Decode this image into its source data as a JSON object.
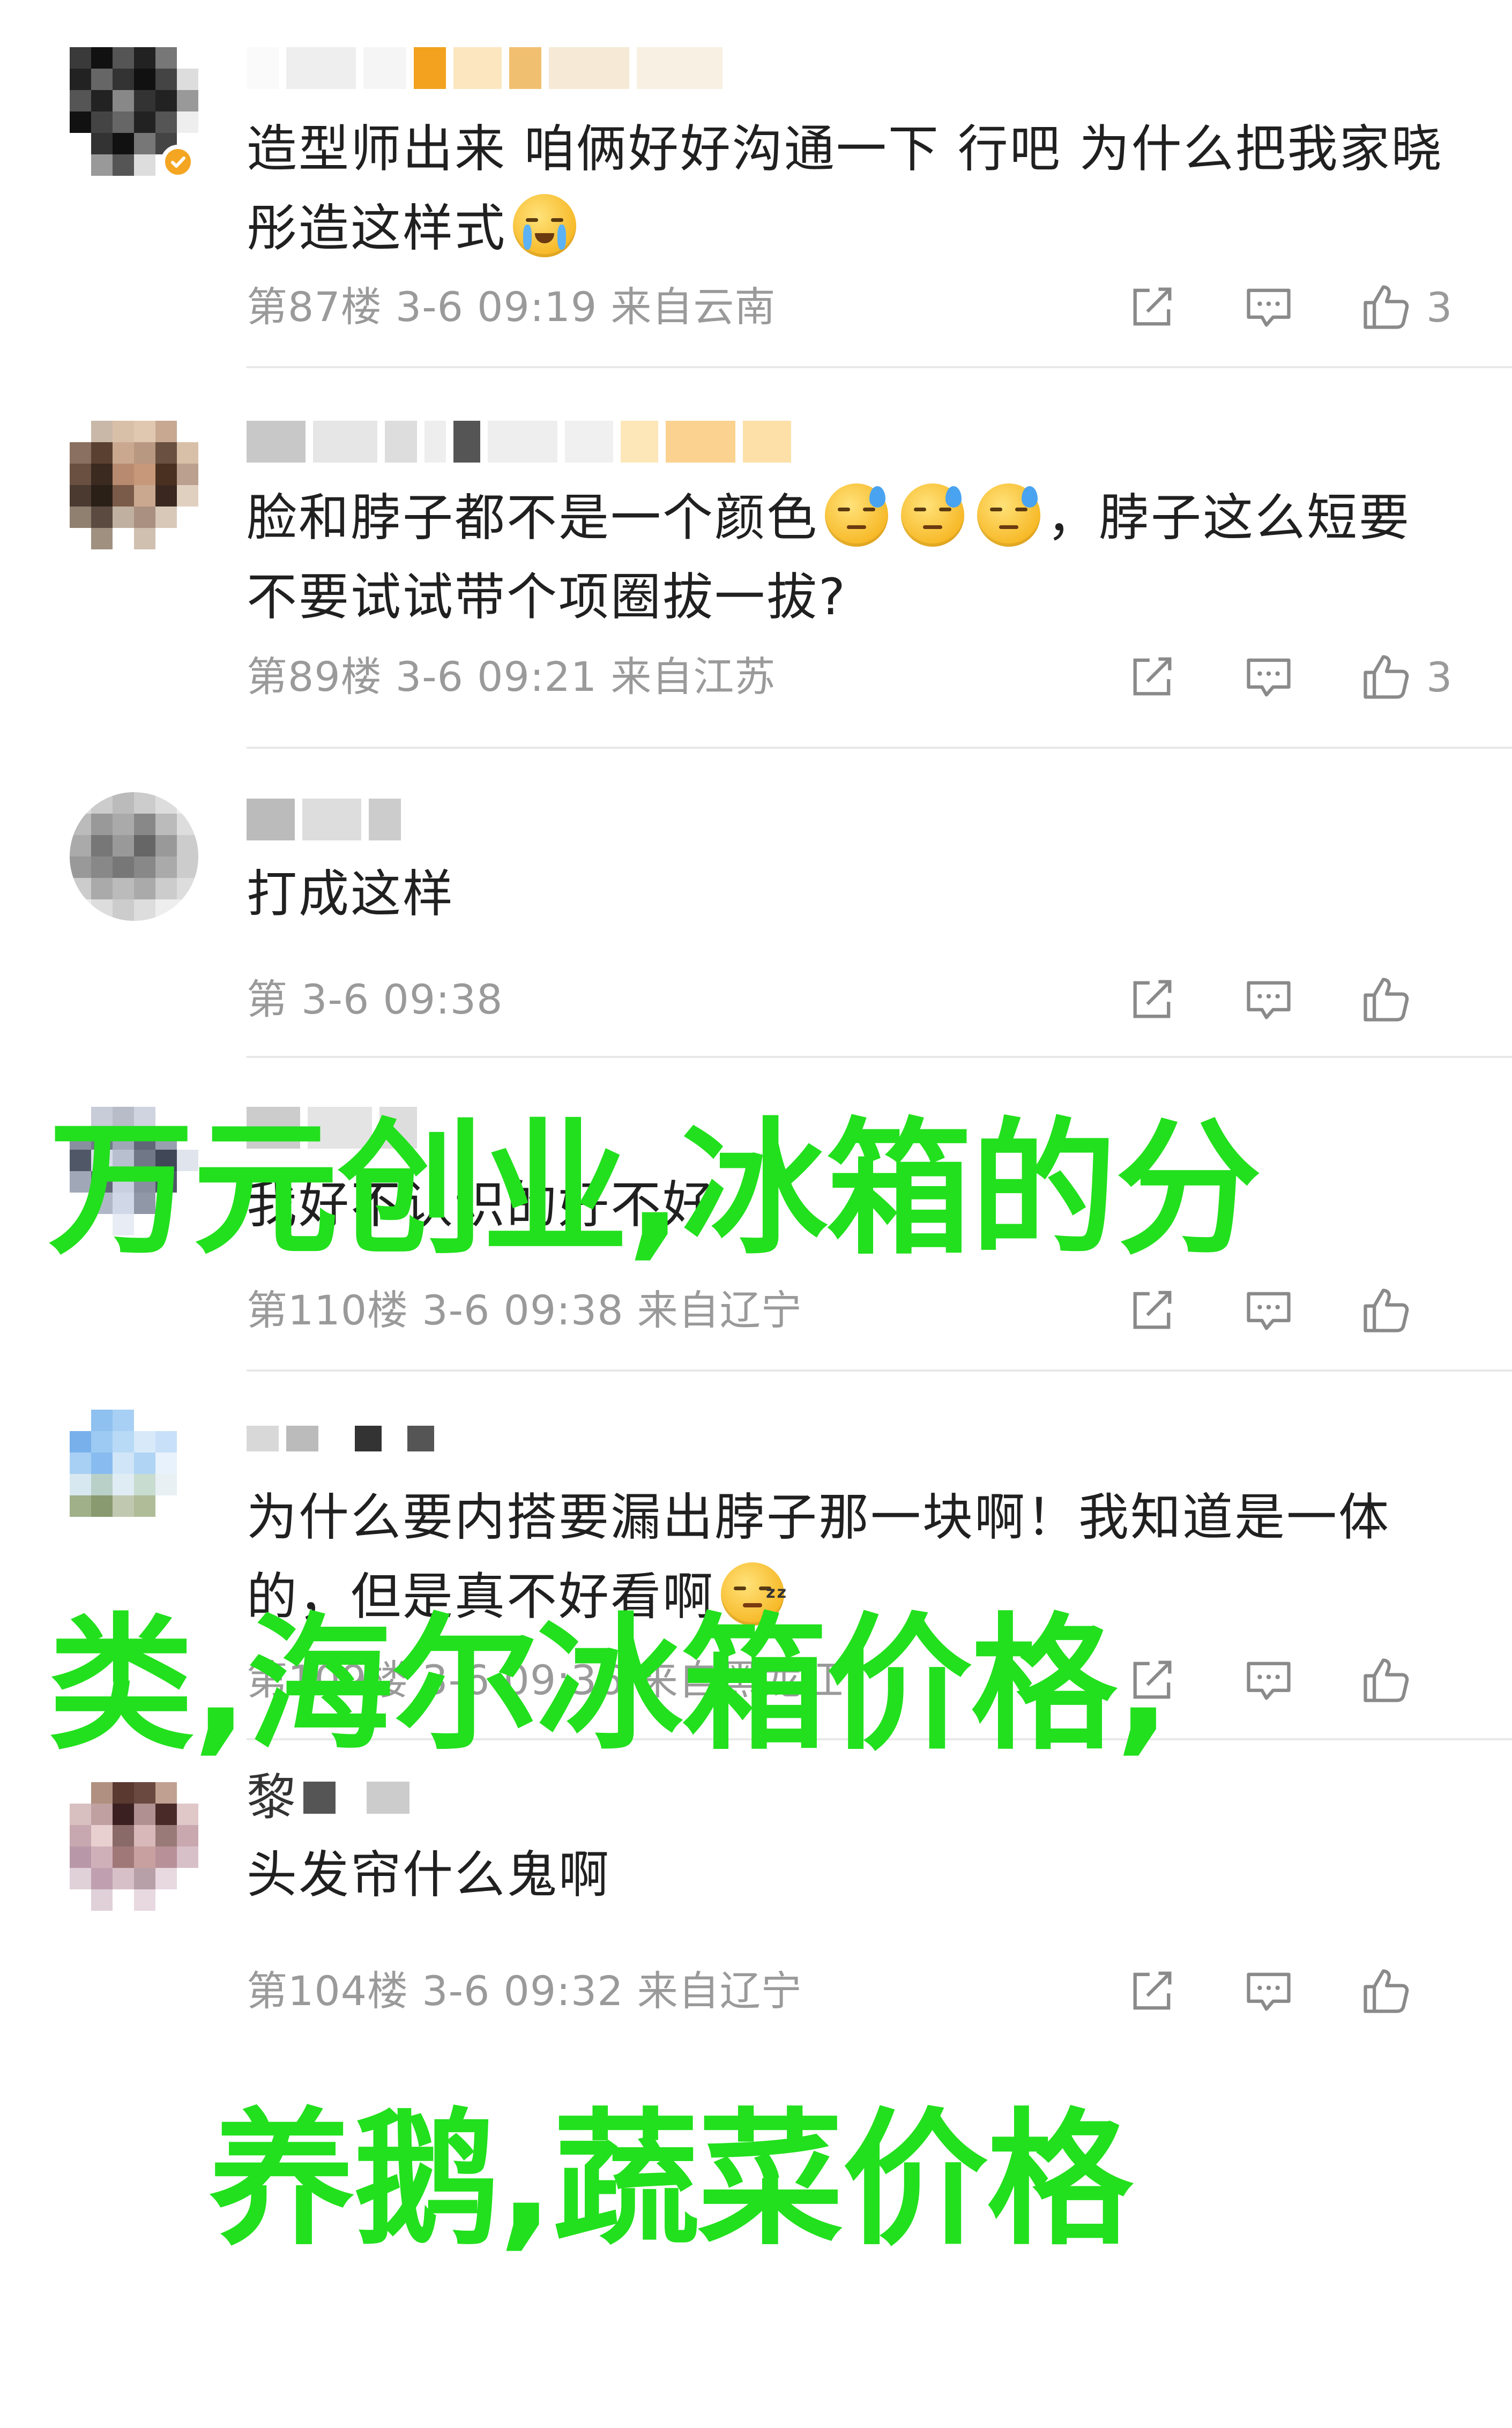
{
  "comments": [
    {
      "text": "造型师出来 咱俩好好沟通一下 行吧 为什么把我家晓彤造这样式",
      "floor": "第87楼",
      "time": "3-6 09:19",
      "location": "来自云南",
      "likes": "3",
      "emoji": "crying-face"
    },
    {
      "text_a": "脸和脖子都不是一个颜色",
      "text_b": "，脖子这么短要不要试试带个项圈拔一拔?",
      "floor": "第89楼",
      "time": "3-6 09:21",
      "location": "来自江苏",
      "likes": "3",
      "emoji": "sweat-face"
    },
    {
      "text": "打成这样",
      "floor": "第",
      "time": "3-6 09:38",
      "location": "",
      "likes": ""
    },
    {
      "text": "我好不认识的好不好",
      "floor": "第110楼",
      "time": "3-6 09:38",
      "location": "来自辽宁",
      "likes": ""
    },
    {
      "text": "为什么要内搭要漏出脖子那一块啊！我知道是一体的，但是真不好看啊",
      "floor": "第109楼",
      "time": "3-6 09:36",
      "location": "来自黑龙江",
      "likes": "",
      "emoji": "sleepy-face"
    },
    {
      "username": "黎",
      "text": "头发帘什么鬼啊",
      "floor": "第104楼",
      "time": "3-6 09:32",
      "location": "来自辽宁",
      "likes": ""
    }
  ],
  "overlay_title": {
    "line1": "万元创业,冰箱的分",
    "line2": "类,海尔冰箱价格,",
    "line3": "养鹅,蔬菜价格"
  },
  "icons": {
    "share": "share-icon",
    "reply": "comment-icon",
    "like": "thumbs-up-icon"
  },
  "colors": {
    "overlay_text": "#22e01d",
    "meta_text": "#9a9a9a",
    "badge": "#f4a623"
  }
}
